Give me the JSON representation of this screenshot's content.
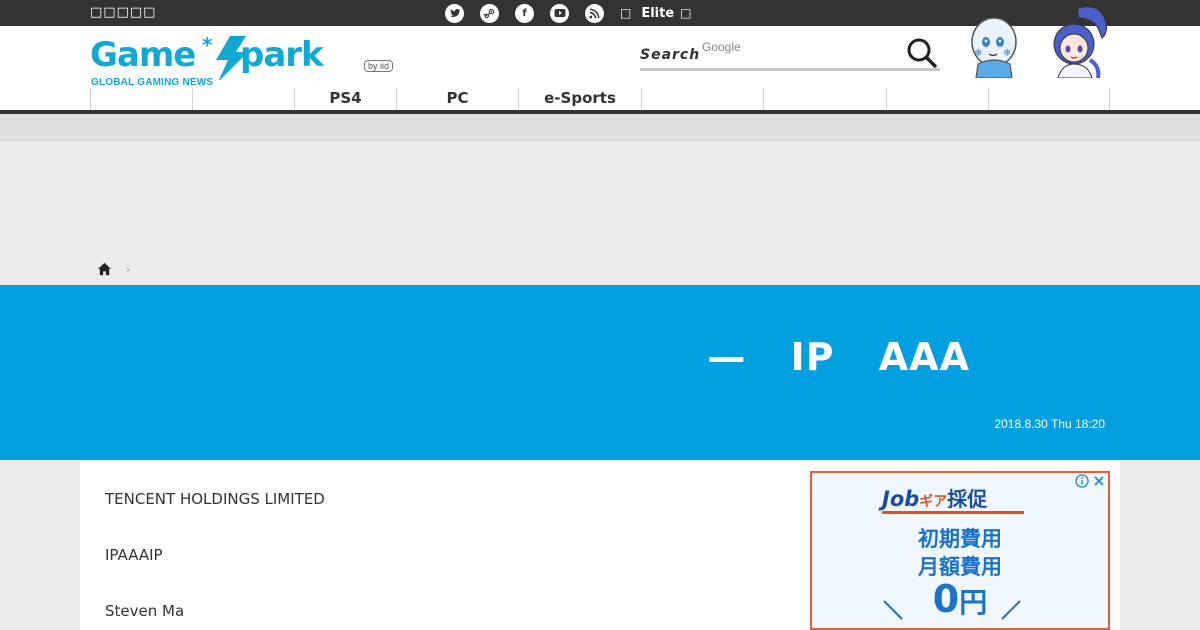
{
  "topbar": {
    "left_text": "□□□□□",
    "social_icons": [
      "twitter-icon",
      "steam-icon",
      "facebook-icon",
      "youtube-icon",
      "rss-icon"
    ],
    "elite_prefix": "□",
    "elite_label": "Elite",
    "elite_suffix": "□"
  },
  "header": {
    "logo_text": "Game*Spark",
    "logo_subtitle": "GLOBAL GAMING NEWS",
    "logo_badge": "by iid",
    "search_label": "Search",
    "search_placeholder": "Google"
  },
  "nav": {
    "items": [
      "",
      "",
      "PS4",
      "PC",
      "e-Sports",
      "",
      "",
      "",
      ""
    ],
    "active_index": 0
  },
  "breadcrumb": {
    "home_icon": "home-icon",
    "separator": "›"
  },
  "article_header": {
    "title": "— IP AAA",
    "date": "2018.8.30 Thu 18:20"
  },
  "article": {
    "paragraphs": [
      "TENCENT HOLDINGS LIMITED",
      "IPAAAIP",
      "Steven Ma"
    ]
  },
  "ad": {
    "brand": "Job",
    "brand_kana": "ギア",
    "brand_tail": "採促",
    "line1": "初期費用",
    "line2": "月額費用",
    "zero": "0",
    "yen": "円",
    "adchoices_icons": [
      "info-icon",
      "close-icon"
    ]
  },
  "colors": {
    "topbar": "#333333",
    "accent": "#02a0e0",
    "logo": "#12a8d6",
    "ad_border": "#e5603a",
    "ad_text": "#1a72c9"
  }
}
